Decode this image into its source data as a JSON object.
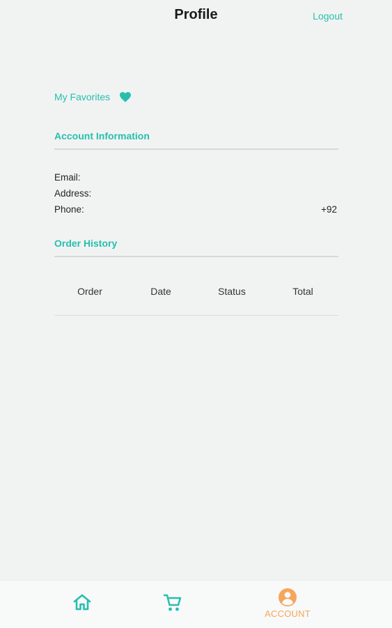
{
  "header": {
    "title": "Profile",
    "logout_label": "Logout"
  },
  "favorites": {
    "label": "My Favorites",
    "icon": "heart-icon"
  },
  "account_information": {
    "title": "Account Information",
    "fields": [
      {
        "label": "Email:",
        "value": ""
      },
      {
        "label": "Address:",
        "value": ""
      },
      {
        "label": "Phone:",
        "value": "+92"
      }
    ]
  },
  "order_history": {
    "title": "Order History",
    "columns": [
      "Order",
      "Date",
      "Status",
      "Total"
    ]
  },
  "bottom_nav": {
    "items": [
      {
        "icon": "home-icon",
        "label": ""
      },
      {
        "icon": "cart-icon",
        "label": ""
      },
      {
        "icon": "account-icon",
        "label": "ACCOUNT",
        "active": true
      }
    ]
  },
  "colors": {
    "accent": "#26bfae",
    "active_tab": "#f5a65b",
    "background": "#f1f3f2"
  }
}
